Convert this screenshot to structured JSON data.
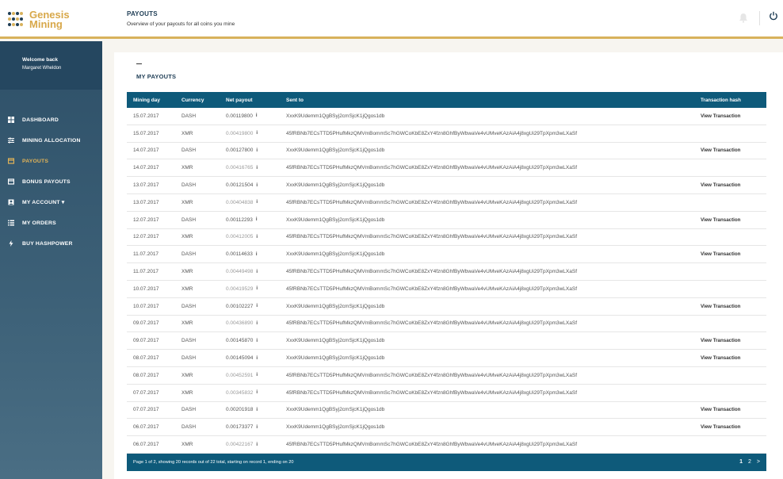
{
  "brand": {
    "line1": "Genesis",
    "line2": "Mining",
    "gold": "#d8a84a",
    "navy": "#1e3d55"
  },
  "header": {
    "title": "PAYOUTS",
    "subtitle": "Overview of your payouts for all coins you mine"
  },
  "icons": {
    "bell": "bell-icon",
    "power": "power-icon"
  },
  "user": {
    "greeting": "Welcome back",
    "name": "Margaret Wheldon"
  },
  "nav": [
    {
      "label": "DASHBOARD",
      "icon": "dashboard-icon"
    },
    {
      "label": "MINING ALLOCATION",
      "icon": "sliders-icon"
    },
    {
      "label": "PAYOUTS",
      "icon": "payouts-icon",
      "active": true
    },
    {
      "label": "BONUS PAYOUTS",
      "icon": "bonus-icon"
    },
    {
      "label": "MY ACCOUNT ▾",
      "icon": "account-icon"
    },
    {
      "label": "MY ORDERS",
      "icon": "list-icon"
    },
    {
      "label": "BUY HASHPOWER",
      "icon": "bolt-icon"
    }
  ],
  "main": {
    "dash": "—",
    "title": "MY PAYOUTS"
  },
  "table": {
    "headers": {
      "day": "Mining day",
      "currency": "Currency",
      "payout": "Net payout",
      "sent": "Sent to",
      "hash": "Transaction hash"
    },
    "info_symbol": "i",
    "rows": [
      {
        "day": "15.07.2017",
        "currency": "DASH",
        "payout": "0.00119800",
        "sent": "XxxK9Udemm1QgBSyj2cmSjcK1jQgos1db",
        "hash": "View Transaction"
      },
      {
        "day": "15.07.2017",
        "currency": "XMR",
        "payout": "0.00419800",
        "sent": "45fRBNb7ECsTTD5PHufMkzQMVmBommSc7hGWCoKbE8ZxY4fzn8GhfByWbwaVe4vUMveKAzAiA4j8xgUi29TpXpm3wLXaSf",
        "hash": ""
      },
      {
        "day": "14.07.2017",
        "currency": "DASH",
        "payout": "0.00127800",
        "sent": "XxxK9Udemm1QgBSyj2cmSjcK1jQgos1db",
        "hash": "View Transaction"
      },
      {
        "day": "14.07.2017",
        "currency": "XMR",
        "payout": "0.00416765",
        "sent": "45fRBNb7ECsTTD5PHufMkzQMVmBommSc7hGWCoKbE8ZxY4fzn8GhfByWbwaVe4vUMveKAzAiA4j8xgUi29TpXpm3wLXaSf",
        "hash": ""
      },
      {
        "day": "13.07.2017",
        "currency": "DASH",
        "payout": "0.00121504",
        "sent": "XxxK9Udemm1QgBSyj2cmSjcK1jQgos1db",
        "hash": "View Transaction"
      },
      {
        "day": "13.07.2017",
        "currency": "XMR",
        "payout": "0.00404838",
        "sent": "45fRBNb7ECsTTD5PHufMkzQMVmBommSc7hGWCoKbE8ZxY4fzn8GhfByWbwaVe4vUMveKAzAiA4j8xgUi29TpXpm3wLXaSf",
        "hash": ""
      },
      {
        "day": "12.07.2017",
        "currency": "DASH",
        "payout": "0.00112293",
        "sent": "XxxK9Udemm1QgBSyj2cmSjcK1jQgos1db",
        "hash": "View Transaction"
      },
      {
        "day": "12.07.2017",
        "currency": "XMR",
        "payout": "0.00412005",
        "sent": "45fRBNb7ECsTTD5PHufMkzQMVmBommSc7hGWCoKbE8ZxY4fzn8GhfByWbwaVe4vUMveKAzAiA4j8xgUi29TpXpm3wLXaSf",
        "hash": ""
      },
      {
        "day": "11.07.2017",
        "currency": "DASH",
        "payout": "0.00114633",
        "sent": "XxxK9Udemm1QgBSyj2cmSjcK1jQgos1db",
        "hash": "View Transaction"
      },
      {
        "day": "11.07.2017",
        "currency": "XMR",
        "payout": "0.00449498",
        "sent": "45fRBNb7ECsTTD5PHufMkzQMVmBommSc7hGWCoKbE8ZxY4fzn8GhfByWbwaVe4vUMveKAzAiA4j8xgUi29TpXpm3wLXaSf",
        "hash": ""
      },
      {
        "day": "10.07.2017",
        "currency": "XMR",
        "payout": "0.00419529",
        "sent": "45fRBNb7ECsTTD5PHufMkzQMVmBommSc7hGWCoKbE8ZxY4fzn8GhfByWbwaVe4vUMveKAzAiA4j8xgUi29TpXpm3wLXaSf",
        "hash": ""
      },
      {
        "day": "10.07.2017",
        "currency": "DASH",
        "payout": "0.00102227",
        "sent": "XxxK9Udemm1QgBSyj2cmSjcK1jQgos1db",
        "hash": "View Transaction"
      },
      {
        "day": "09.07.2017",
        "currency": "XMR",
        "payout": "0.00436890",
        "sent": "45fRBNb7ECsTTD5PHufMkzQMVmBommSc7hGWCoKbE8ZxY4fzn8GhfByWbwaVe4vUMveKAzAiA4j8xgUi29TpXpm3wLXaSf",
        "hash": ""
      },
      {
        "day": "09.07.2017",
        "currency": "DASH",
        "payout": "0.00145870",
        "sent": "XxxK9Udemm1QgBSyj2cmSjcK1jQgos1db",
        "hash": "View Transaction"
      },
      {
        "day": "08.07.2017",
        "currency": "DASH",
        "payout": "0.00145094",
        "sent": "XxxK9Udemm1QgBSyj2cmSjcK1jQgos1db",
        "hash": "View Transaction"
      },
      {
        "day": "08.07.2017",
        "currency": "XMR",
        "payout": "0.00452591",
        "sent": "45fRBNb7ECsTTD5PHufMkzQMVmBommSc7hGWCoKbE8ZxY4fzn8GhfByWbwaVe4vUMveKAzAiA4j8xgUi29TpXpm3wLXaSf",
        "hash": ""
      },
      {
        "day": "07.07.2017",
        "currency": "XMR",
        "payout": "0.00345832",
        "sent": "45fRBNb7ECsTTD5PHufMkzQMVmBommSc7hGWCoKbE8ZxY4fzn8GhfByWbwaVe4vUMveKAzAiA4j8xgUi29TpXpm3wLXaSf",
        "hash": ""
      },
      {
        "day": "07.07.2017",
        "currency": "DASH",
        "payout": "0.00201918",
        "sent": "XxxK9Udemm1QgBSyj2cmSjcK1jQgos1db",
        "hash": "View Transaction"
      },
      {
        "day": "06.07.2017",
        "currency": "DASH",
        "payout": "0.00173377",
        "sent": "XxxK9Udemm1QgBSyj2cmSjcK1jQgos1db",
        "hash": "View Transaction"
      },
      {
        "day": "06.07.2017",
        "currency": "XMR",
        "payout": "0.00422167",
        "sent": "45fRBNb7ECsTTD5PHufMkzQMVmBommSc7hGWCoKbE8ZxY4fzn8GhfByWbwaVe4vUMveKAzAiA4j8xgUi29TpXpm3wLXaSf",
        "hash": ""
      }
    ],
    "footer": "Page 1 of 2, showing 20 records out of 22 total, starting on record 1, ending on 20",
    "pages": [
      "1",
      "2"
    ],
    "next": ">"
  }
}
